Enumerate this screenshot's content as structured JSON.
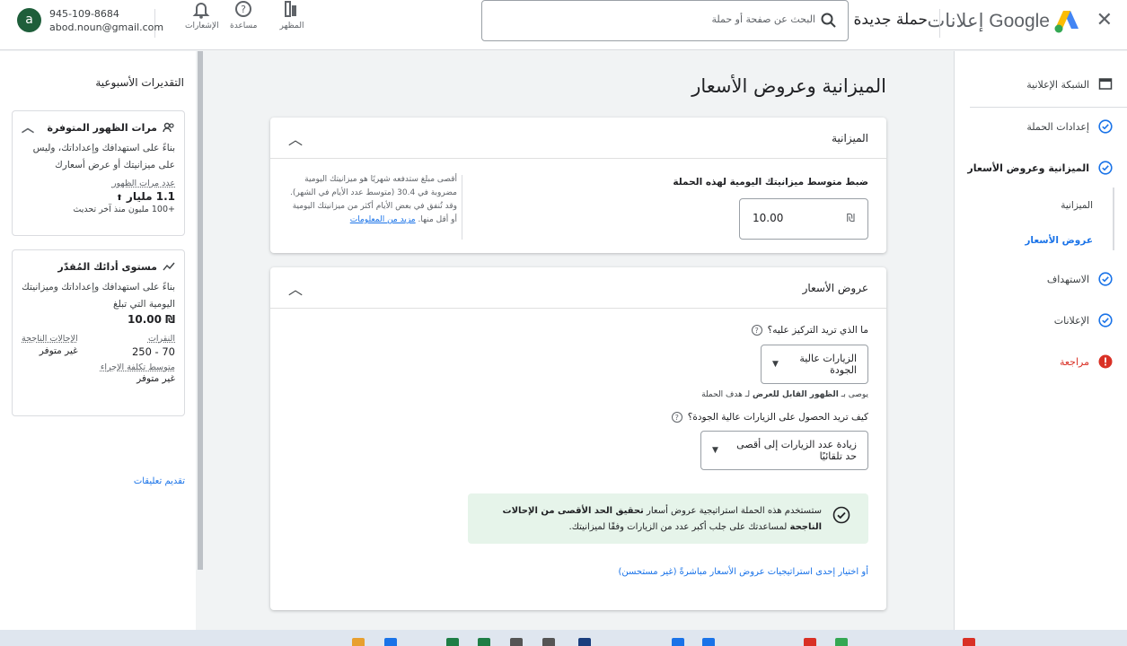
{
  "header": {
    "close_glyph": "✕",
    "brand": "إعلانات Google",
    "page_title": "حملة جديدة",
    "search_placeholder": "البحث عن صفحة أو حملة",
    "tools": [
      {
        "label": "المظهر",
        "icon": "appearance-icon"
      },
      {
        "label": "مساعدة",
        "icon": "help-icon"
      },
      {
        "label": "الإشعارات",
        "icon": "bell-icon"
      }
    ],
    "account": {
      "phone": "945-109-8684",
      "email": "abod.noun@gmail.com",
      "avatar_letter": "a"
    }
  },
  "nav": {
    "items": [
      {
        "label": "الشبكة الإعلانية",
        "icon": "display-network-icon"
      },
      {
        "label": "إعدادات الحملة",
        "icon": "check-circle-icon"
      },
      {
        "label": "الميزانية وعروض الأسعار",
        "icon": "check-circle-icon"
      },
      {
        "label": "الاستهداف",
        "icon": "check-circle-icon"
      },
      {
        "label": "الإعلانات",
        "icon": "check-circle-icon"
      },
      {
        "label": "مراجعة",
        "icon": "error-icon"
      }
    ],
    "sub_items": [
      "الميزانية",
      "عروض الأسعار"
    ]
  },
  "main": {
    "title": "الميزانية وعروض الأسعار",
    "budget": {
      "header": "الميزانية",
      "label": "ضبط متوسط ميزانيتك اليومية لهذه الحملة",
      "currency": "₪",
      "value": "10.00",
      "help": "أقصى مبلغ ستدفعه شهريًا هو ميزانيتك اليومية مضروبة في 30.4 (متوسط عدد الأيام في الشهر). وقد تُنفق في بعض الأيام أكثر من ميزانيتك اليومية أو أقل منها.",
      "help_link": "مزيد من المعلومات"
    },
    "bidding": {
      "header": "عروض الأسعار",
      "q1": "ما الذي تريد التركيز عليه؟",
      "q1_value": "الزيارات عالية الجودة",
      "recommend_prefix": "يوصى بـ",
      "recommend_bold": "الظهور القابل للعرض",
      "recommend_suffix": "لـ هدف الحملة",
      "q2": "كيف تريد الحصول على الزيارات عالية الجودة؟",
      "q2_value": "زيادة عدد الزيارات إلى أقصى حد تلقائيًا",
      "info_prefix": "ستستخدم هذه الحملة استراتيجية عروض أسعار",
      "info_bold": "تحقيق الحد الأقصى من الإحالات الناجحة",
      "info_suffix": "لمساعدتك على جلب أكبر عدد من الزيارات وفقًا لميزانيتك.",
      "alt_link": "أو اختيار إحدى استراتيجيات عروض الأسعار مباشرةً (غير مستحسن)"
    }
  },
  "estimates": {
    "title": "التقديرات الأسبوعية",
    "impressions_card": {
      "title": "مرات الظهور المتوفرة",
      "desc": "بناءً على استهدافك وإعداداتك، وليس على ميزانيتك أو عرض أسعارك",
      "metric_label": "عدد مرات الظهور",
      "metric_value": "1.1 مليار",
      "metric_note": "+100 مليون منذ آخر تحديث"
    },
    "performance_card": {
      "title": "مستوى أدائك المُقدّر",
      "desc": "بناءً على استهدافك وإعداداتك وميزانيتك اليومية التي تبلغ",
      "budget": "₪ 10.00",
      "clicks_label": "النقرات",
      "clicks_value": "70 - 250",
      "conv_label": "الإحالات الناجحة",
      "conv_value": "غير متوفر",
      "cpa_label": "متوسط تكلفة الإجراء",
      "cpa_value": "غير متوفر"
    },
    "feedback": "تقديم تعليقات"
  },
  "colors": {
    "accent": "#1a73e8",
    "success_bg": "#e6f4ea",
    "error": "#d93025"
  }
}
